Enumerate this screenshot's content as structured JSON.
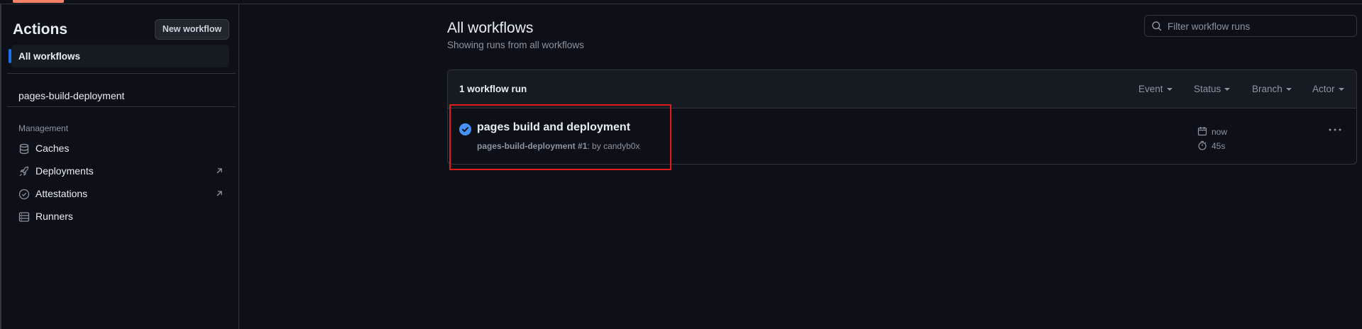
{
  "sidebar": {
    "title": "Actions",
    "new_workflow_label": "New workflow",
    "all_workflows_label": "All workflows",
    "workflows": [
      {
        "label": "pages-build-deployment"
      }
    ],
    "management_heading": "Management",
    "management_items": [
      {
        "label": "Caches",
        "icon": "database-icon",
        "external": false
      },
      {
        "label": "Deployments",
        "icon": "rocket-icon",
        "external": true
      },
      {
        "label": "Attestations",
        "icon": "check-circle-icon",
        "external": true
      },
      {
        "label": "Runners",
        "icon": "server-icon",
        "external": false
      }
    ]
  },
  "main": {
    "title": "All workflows",
    "subtitle": "Showing runs from all workflows",
    "search": {
      "placeholder": "Filter workflow runs",
      "value": ""
    },
    "runs_header": {
      "count_label": "1 workflow run",
      "filters": [
        {
          "label": "Event"
        },
        {
          "label": "Status"
        },
        {
          "label": "Branch"
        },
        {
          "label": "Actor"
        }
      ]
    },
    "runs": [
      {
        "title": "pages build and deployment",
        "workflow": "pages-build-deployment",
        "run_number": "#1",
        "by_text": ": by candyb0x",
        "time_label": "now",
        "duration_label": "45s",
        "status": "success",
        "status_color": "#4493f8"
      }
    ]
  },
  "colors": {
    "accent_tab": "#f78166",
    "nav_indicator": "#1f6feb",
    "highlight_box": "#e01b1b"
  }
}
